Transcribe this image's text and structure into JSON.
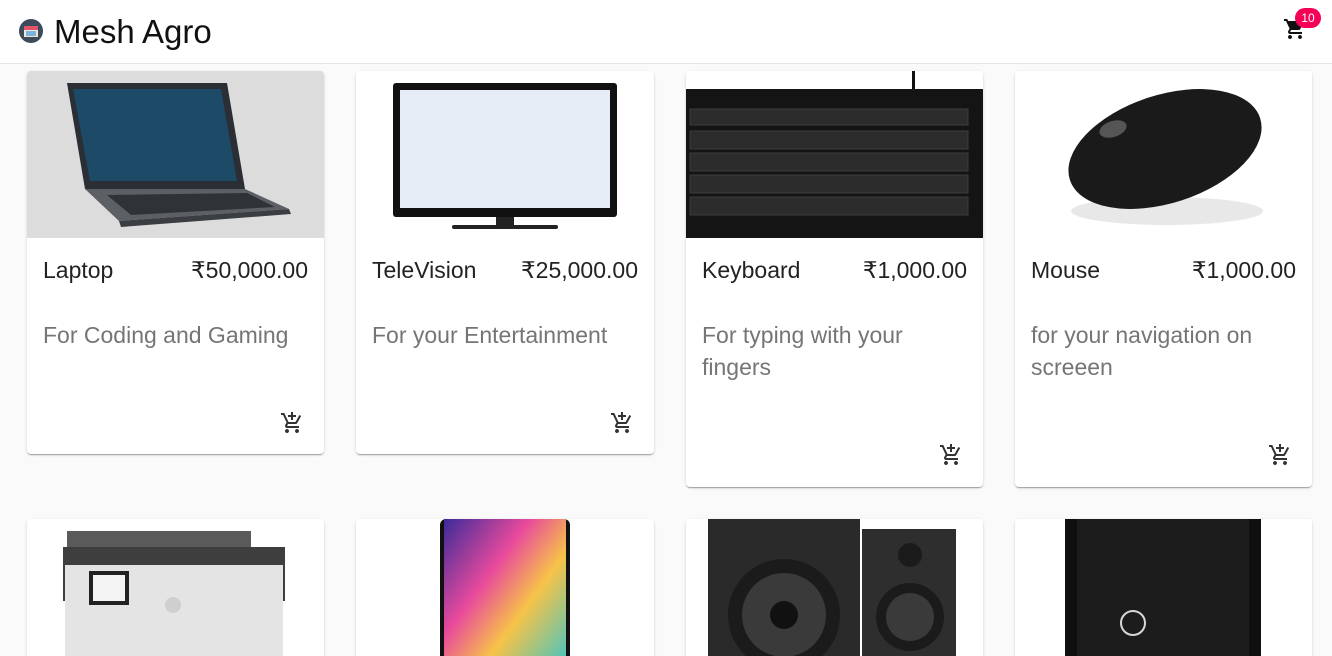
{
  "app": {
    "title": "Mesh Agro",
    "cart_count": "10"
  },
  "colors": {
    "badge": "#f50057",
    "appbar": "#ffffff",
    "description": "#757575"
  },
  "icons": {
    "logo": "store-logo-icon",
    "cart": "shopping-cart-icon",
    "add_to_cart": "add-shopping-cart-icon"
  },
  "products": [
    {
      "name": "Laptop",
      "price": "₹50,000.00",
      "description": "For Coding and Gaming"
    },
    {
      "name": "TeleVision",
      "price": "₹25,000.00",
      "description": "For your Entertainment"
    },
    {
      "name": "Keyboard",
      "price": "₹1,000.00",
      "description": "For typing with your fingers"
    },
    {
      "name": "Mouse",
      "price": "₹1,000.00",
      "description": "for your navigation on screeen"
    }
  ],
  "products_partial": [
    {
      "image": "printer"
    },
    {
      "image": "smartphone"
    },
    {
      "image": "speakers"
    },
    {
      "image": "desktop-tower"
    }
  ]
}
